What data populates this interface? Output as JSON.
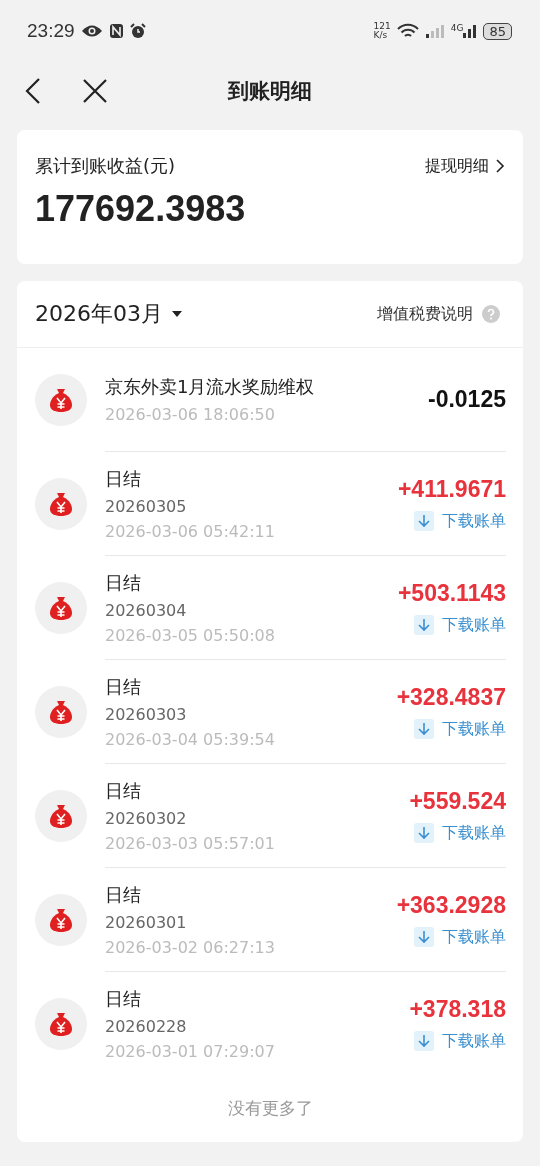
{
  "status_bar": {
    "time": "23:29",
    "speed_value": "121",
    "speed_unit": "K/s",
    "network": "4G",
    "battery": "85"
  },
  "header": {
    "title": "到账明细"
  },
  "summary": {
    "label": "累计到账收益(元)",
    "link": "提现明细",
    "amount": "177692.3983"
  },
  "list": {
    "month": "2026年03月",
    "tax_link": "增值税费说明",
    "footer": "没有更多了",
    "rows": [
      {
        "kind": "deduction",
        "title": "京东外卖1月流水奖励维权",
        "time": "2026-03-06 18:06:50",
        "amount": "-0.0125"
      },
      {
        "kind": "daily",
        "title": "日结",
        "code": "20260305",
        "time": "2026-03-06 05:42:11",
        "amount": "+411.9671",
        "action": "下载账单"
      },
      {
        "kind": "daily",
        "title": "日结",
        "code": "20260304",
        "time": "2026-03-05 05:50:08",
        "amount": "+503.1143",
        "action": "下载账单"
      },
      {
        "kind": "daily",
        "title": "日结",
        "code": "20260303",
        "time": "2026-03-04 05:39:54",
        "amount": "+328.4837",
        "action": "下载账单"
      },
      {
        "kind": "daily",
        "title": "日结",
        "code": "20260302",
        "time": "2026-03-03 05:57:01",
        "amount": "+559.524",
        "action": "下载账单"
      },
      {
        "kind": "daily",
        "title": "日结",
        "code": "20260301",
        "time": "2026-03-02 06:27:13",
        "amount": "+363.2928",
        "action": "下载账单"
      },
      {
        "kind": "daily",
        "title": "日结",
        "code": "20260228",
        "time": "2026-03-01 07:29:07",
        "amount": "+378.318",
        "action": "下载账单"
      }
    ]
  }
}
